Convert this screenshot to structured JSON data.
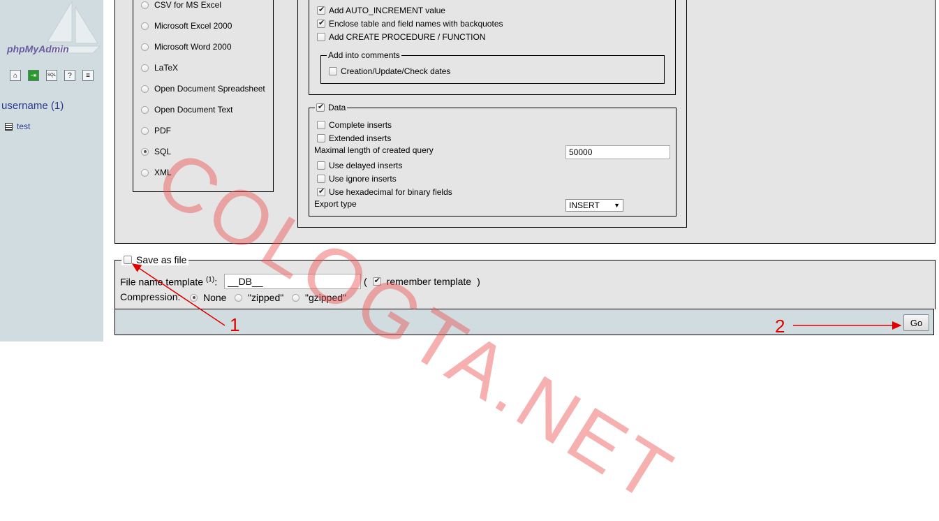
{
  "sidebar": {
    "logo_text": "phpMyAdmin",
    "icons": [
      "home-icon",
      "exit-icon",
      "sql-icon",
      "help-icon",
      "docs-icon"
    ],
    "db_label": "username (1)",
    "tables": [
      {
        "name": "test"
      }
    ]
  },
  "export_formats": [
    {
      "label": "CSV for MS Excel",
      "selected": false
    },
    {
      "label": "Microsoft Excel 2000",
      "selected": false
    },
    {
      "label": "Microsoft Word 2000",
      "selected": false
    },
    {
      "label": "LaTeX",
      "selected": false
    },
    {
      "label": "Open Document Spreadsheet",
      "selected": false
    },
    {
      "label": "Open Document Text",
      "selected": false
    },
    {
      "label": "PDF",
      "selected": false
    },
    {
      "label": "SQL",
      "selected": true
    },
    {
      "label": "XML",
      "selected": false
    }
  ],
  "structure_options": {
    "auto_increment": {
      "label": "Add AUTO_INCREMENT value",
      "checked": true
    },
    "backquotes": {
      "label": "Enclose table and field names with backquotes",
      "checked": true
    },
    "create_procedure": {
      "label": "Add CREATE PROCEDURE / FUNCTION",
      "checked": false
    },
    "comments_legend": "Add into comments",
    "dates": {
      "label": "Creation/Update/Check dates",
      "checked": false
    }
  },
  "data_options": {
    "legend": "Data",
    "legend_checked": true,
    "complete_inserts": {
      "label": "Complete inserts",
      "checked": false
    },
    "extended_inserts": {
      "label": "Extended inserts",
      "checked": false
    },
    "max_query_label": "Maximal length of created query",
    "max_query_value": "50000",
    "delayed_inserts": {
      "label": "Use delayed inserts",
      "checked": false
    },
    "ignore_inserts": {
      "label": "Use ignore inserts",
      "checked": false
    },
    "hex_binary": {
      "label": "Use hexadecimal for binary fields",
      "checked": true
    },
    "export_type_label": "Export type",
    "export_type_value": "INSERT"
  },
  "save_file": {
    "legend": "Save as file",
    "checked": false,
    "template_label": "File name template",
    "template_sup": "(1)",
    "template_colon": ":",
    "template_value": "__DB__",
    "paren_open": "(",
    "remember_label": "remember template",
    "remember_checked": true,
    "paren_close": ")",
    "compression_label": "Compression:",
    "compression_options": [
      {
        "label": "None",
        "selected": true
      },
      {
        "label": "\"zipped\"",
        "selected": false
      },
      {
        "label": "\"gzipped\"",
        "selected": false
      }
    ]
  },
  "go_button": "Go",
  "annotations": {
    "one": "1",
    "two": "2",
    "color": "#e00000"
  },
  "watermark": "COLOGTA.NET"
}
